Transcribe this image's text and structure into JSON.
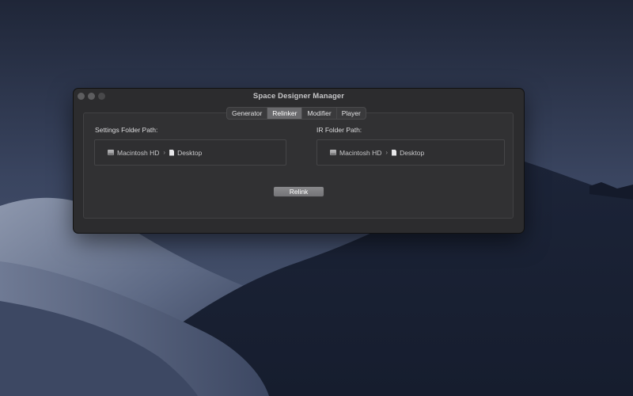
{
  "window": {
    "title": "Space Designer Manager"
  },
  "tabs": [
    {
      "label": "Generator",
      "active": false
    },
    {
      "label": "Relinker",
      "active": true
    },
    {
      "label": "Modifier",
      "active": false
    },
    {
      "label": "Player",
      "active": false
    }
  ],
  "settings_folder": {
    "label": "Settings Folder Path:",
    "path": [
      {
        "name": "Macintosh HD",
        "icon": "hard-drive-icon"
      },
      {
        "name": "Desktop",
        "icon": "document-icon"
      }
    ]
  },
  "ir_folder": {
    "label": "IR Folder Path:",
    "path": [
      {
        "name": "Macintosh HD",
        "icon": "hard-drive-icon"
      },
      {
        "name": "Desktop",
        "icon": "document-icon"
      }
    ]
  },
  "relink_button": {
    "label": "Relink"
  },
  "colors": {
    "window_bg": "#2c2c2e",
    "active_tab": "#6a6a6d",
    "button": "#7e7e81"
  }
}
